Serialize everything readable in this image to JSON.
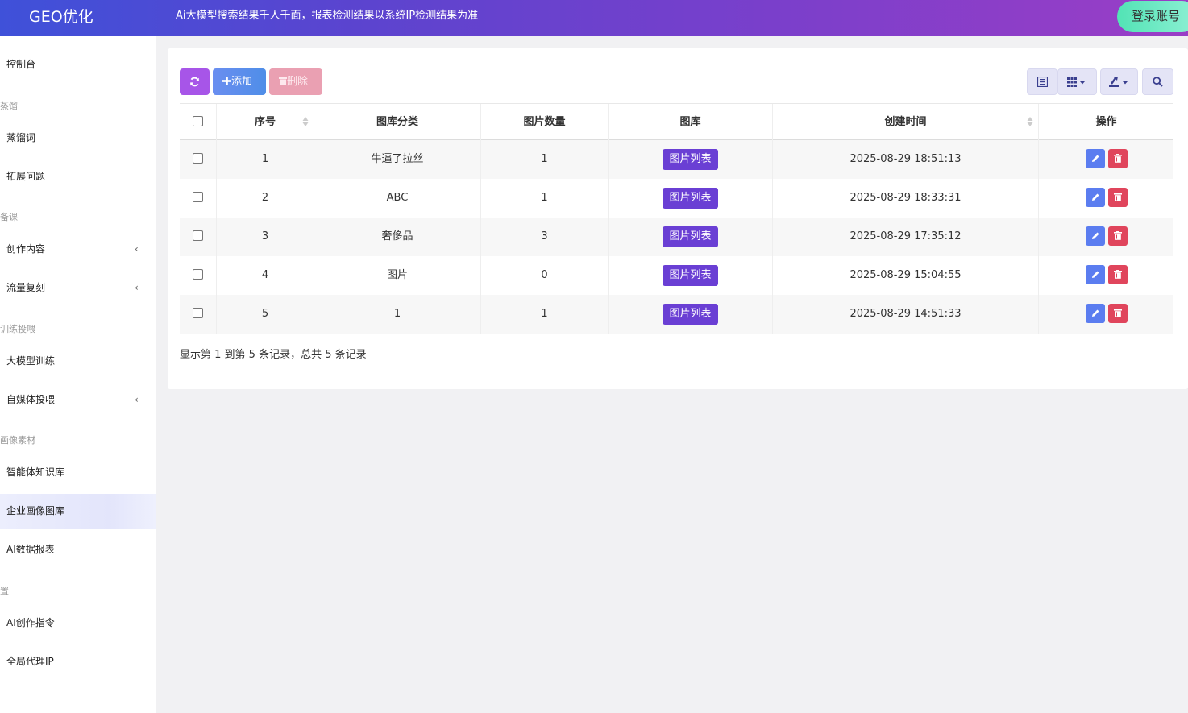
{
  "header": {
    "brand": "GEO优化",
    "notice": "Ai大模型搜索结果千人千面，报表检测结果以系统IP检测结果为准",
    "login_label": "登录账号"
  },
  "sidebar": {
    "items": [
      {
        "label": "控制台"
      },
      {
        "group": "蒸馏"
      },
      {
        "label": "蒸馏词"
      },
      {
        "label": "拓展问题"
      },
      {
        "group": "备课"
      },
      {
        "label": "创作内容",
        "chevron": "‹"
      },
      {
        "label": "流量复刻",
        "chevron": "‹"
      },
      {
        "group": "训练投喂"
      },
      {
        "label": "大模型训练"
      },
      {
        "label": "自媒体投喂",
        "chevron": "‹"
      },
      {
        "group": "画像素材"
      },
      {
        "label": "智能体知识库"
      },
      {
        "label": "企业画像图库",
        "active": true
      },
      {
        "label": "AI数据报表"
      },
      {
        "group": "置"
      },
      {
        "label": "AI创作指令"
      },
      {
        "label": "全局代理IP"
      }
    ]
  },
  "toolbar": {
    "add_label": "添加",
    "delete_label": "删除",
    "icons": {
      "refresh": "refresh-icon",
      "plus": "plus-icon",
      "trash": "trash-icon",
      "list": "list-view-icon",
      "columns": "grid-columns-icon",
      "export": "export-icon",
      "search": "search-icon"
    }
  },
  "table": {
    "columns": [
      "序号",
      "图库分类",
      "图片数量",
      "图库",
      "创建时间",
      "操作"
    ],
    "gallery_button_label": "图片列表",
    "rows": [
      {
        "id": "1",
        "category": "牛逼了拉丝",
        "count": "1",
        "created": "2025-08-29 18:51:13"
      },
      {
        "id": "2",
        "category": "ABC",
        "count": "1",
        "created": "2025-08-29 18:33:31"
      },
      {
        "id": "3",
        "category": "奢侈品",
        "count": "3",
        "created": "2025-08-29 17:35:12"
      },
      {
        "id": "4",
        "category": "图片",
        "count": "0",
        "created": "2025-08-29 15:04:55"
      },
      {
        "id": "5",
        "category": "1",
        "count": "1",
        "created": "2025-08-29 14:51:33"
      }
    ]
  },
  "pagination": {
    "summary": "显示第 1 到第 5 条记录，总共 5 条记录"
  },
  "colors": {
    "header_gradient": [
      "#3f51d9",
      "#9a3ec6"
    ],
    "accent": "#6a3fd4",
    "edit": "#5b7df0",
    "delete": "#e0455c"
  }
}
